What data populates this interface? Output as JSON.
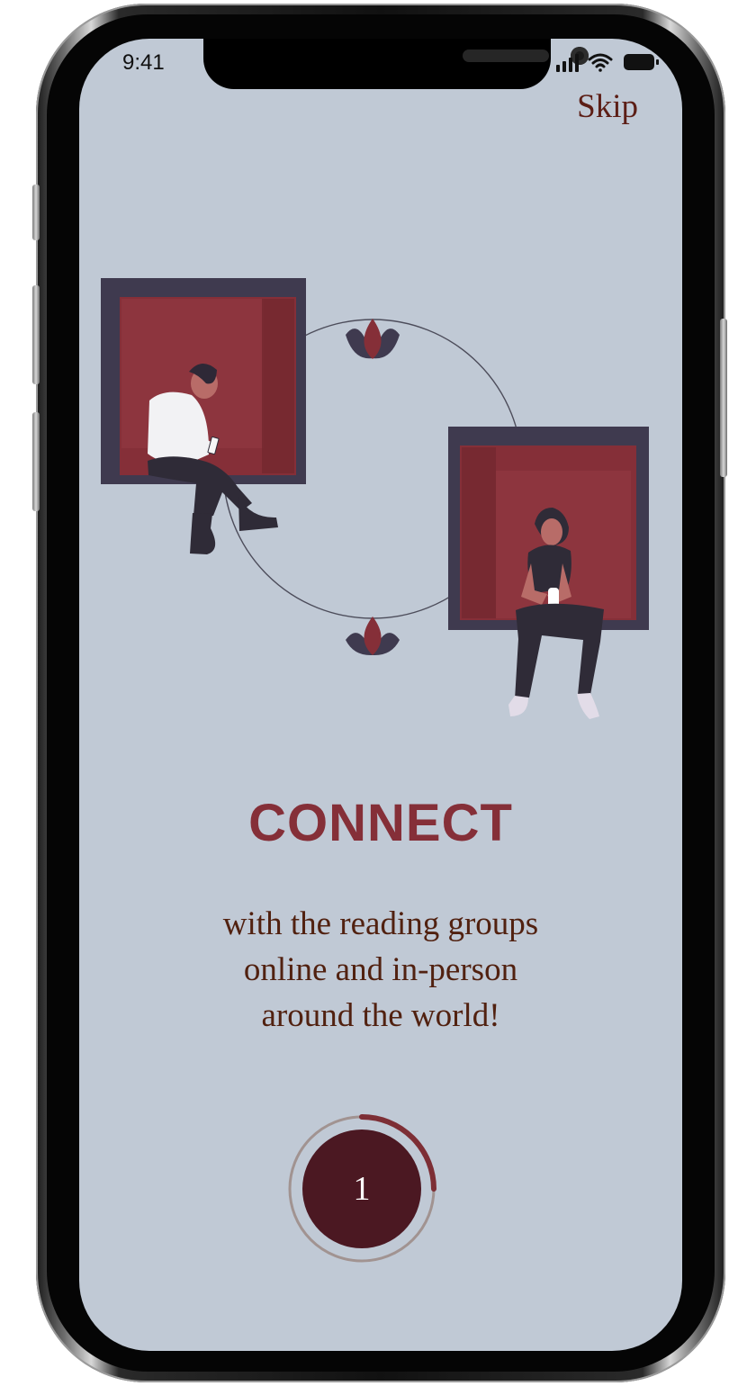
{
  "status_bar": {
    "time": "9:41",
    "icons": [
      "signal-icon",
      "wifi-icon",
      "battery-icon"
    ]
  },
  "header": {
    "skip_label": "Skip"
  },
  "illustration": {
    "name": "people-connecting-illustration"
  },
  "content": {
    "title": "CONNECT",
    "description_lines": [
      "with the reading groups",
      "online and in-person",
      "around the world!"
    ]
  },
  "progress": {
    "step_label": "1",
    "progress_value": 0.33
  },
  "colors": {
    "screen_background": "#c0c9d5",
    "title": "#852f38",
    "text": "#512110",
    "button": "#4b1822",
    "accent_dark": "#3f3a4f",
    "accent_red": "#852f38"
  }
}
